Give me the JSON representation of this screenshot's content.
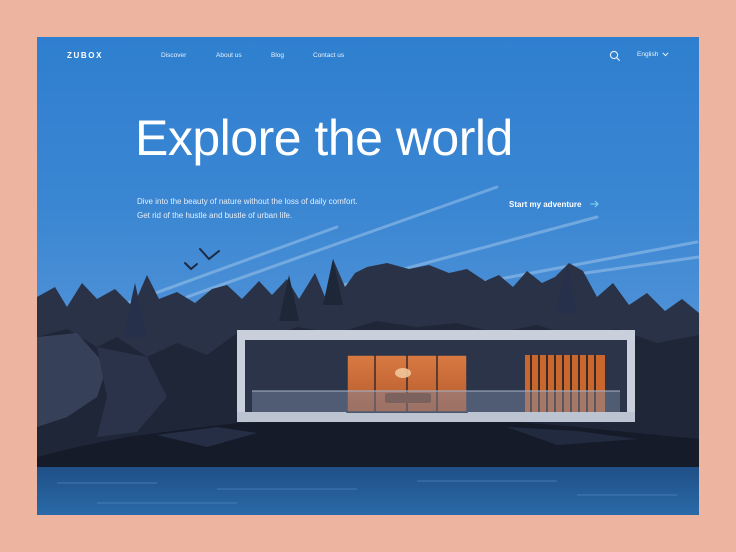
{
  "brand": {
    "logo_text": "ZUBOX"
  },
  "nav": {
    "items": [
      {
        "label": "Discover"
      },
      {
        "label": "About us"
      },
      {
        "label": "Blog"
      },
      {
        "label": "Contact us"
      }
    ],
    "language": "English",
    "search_icon": "search-icon",
    "language_icon": "chevron-down-icon"
  },
  "hero": {
    "title": "Explore the world",
    "description": "Dive into the beauty of nature without the loss of daily comfort. Get rid of the hustle and bustle of urban life.",
    "cta_label": "Start my adventure",
    "cta_icon": "arrow-right-icon"
  },
  "colors": {
    "page_background": "#EDB4A0",
    "sky": "#3A86D2",
    "text": "#FFFFFF",
    "cta_arrow": "#7FD4F0",
    "house_glow": "#E28A4E",
    "rocks": "#1E2738"
  }
}
